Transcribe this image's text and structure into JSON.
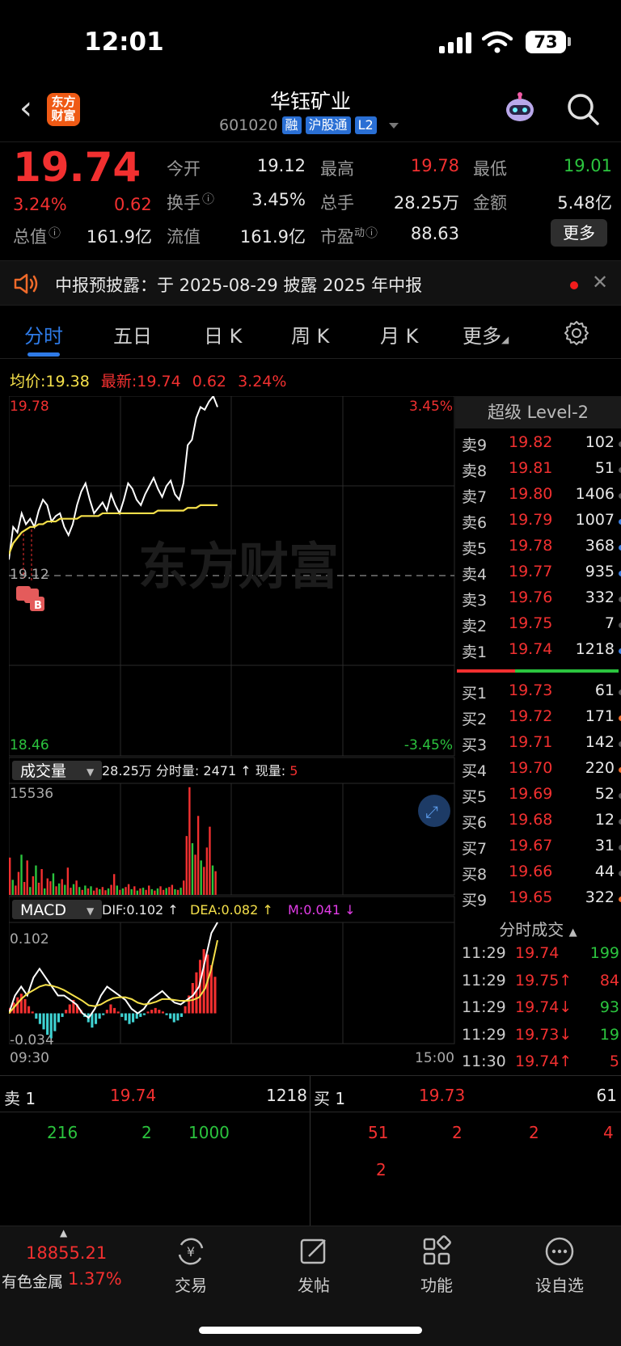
{
  "status": {
    "time": "12:01",
    "battery": "73"
  },
  "header": {
    "logo_text": "东方财富",
    "title": "华钰矿业",
    "code": "601020",
    "tags": [
      "融",
      "沪股通",
      "L2"
    ]
  },
  "quote": {
    "price": "19.74",
    "change_pct": "3.24%",
    "change": "0.62",
    "open_label": "今开",
    "open": "19.12",
    "high_label": "最高",
    "high": "19.78",
    "low_label": "最低",
    "low": "19.01",
    "turnover_label": "换手",
    "turnover": "3.45%",
    "volume_label": "总手",
    "volume": "28.25万",
    "amount_label": "金额",
    "amount": "5.48亿",
    "mktcap_label": "总值",
    "mktcap": "161.9亿",
    "float_label": "流值",
    "float": "161.9亿",
    "pe_label": "市盈",
    "pe_sup": "动",
    "pe": "88.63",
    "more_button": "更多"
  },
  "notice": {
    "text": "中报预披露：于 2025-08-29 披露 2025 年中报"
  },
  "tabs": [
    {
      "label": "分时",
      "active": true
    },
    {
      "label": "五日",
      "active": false
    },
    {
      "label": "日 K",
      "active": false
    },
    {
      "label": "周 K",
      "active": false
    },
    {
      "label": "月 K",
      "active": false
    },
    {
      "label": "更多",
      "active": false
    }
  ],
  "intraday_info": {
    "avg_label": "均价:",
    "avg": "19.38",
    "latest_label": "最新:",
    "latest": "19.74",
    "change": "0.62",
    "change_pct": "3.24%"
  },
  "chart_data": [
    {
      "type": "line",
      "title": "",
      "y_top_label": "19.78",
      "y_mid_label": "19.12",
      "y_bottom_label": "18.46",
      "pct_top_label": "3.45%",
      "pct_bottom_label": "-3.45%",
      "ylim": [
        18.46,
        19.78
      ],
      "series": [
        {
          "name": "",
          "color": "#ffffff",
          "values": [
            19.18,
            19.3,
            19.28,
            19.35,
            19.31,
            19.33,
            19.3,
            19.36,
            19.4,
            19.38,
            19.32,
            19.34,
            19.35,
            19.3,
            19.27,
            19.31,
            19.38,
            19.43,
            19.46,
            19.4,
            19.35,
            19.37,
            19.39,
            19.36,
            19.42,
            19.38,
            19.35,
            19.4,
            19.46,
            19.44,
            19.4,
            19.38,
            19.42,
            19.45,
            19.48,
            19.44,
            19.41,
            19.45,
            19.47,
            19.42,
            19.4,
            19.46,
            19.6,
            19.62,
            19.7,
            19.74,
            19.73,
            19.76,
            19.78,
            19.74
          ]
        },
        {
          "name": "",
          "color": "#f5e04a",
          "values": [
            19.2,
            19.24,
            19.26,
            19.28,
            19.29,
            19.3,
            19.3,
            19.31,
            19.31,
            19.32,
            19.32,
            19.32,
            19.33,
            19.33,
            19.33,
            19.33,
            19.33,
            19.34,
            19.34,
            19.34,
            19.34,
            19.34,
            19.35,
            19.35,
            19.35,
            19.35,
            19.35,
            19.35,
            19.35,
            19.35,
            19.35,
            19.35,
            19.35,
            19.35,
            19.35,
            19.36,
            19.36,
            19.36,
            19.36,
            19.36,
            19.36,
            19.36,
            19.37,
            19.37,
            19.37,
            19.38,
            19.38,
            19.38,
            19.38,
            19.38
          ]
        }
      ]
    },
    {
      "type": "bar",
      "title": "成交量",
      "summary": "28.25万",
      "minute_label": "分时量:",
      "minute_value": "2471",
      "current_label": "现量:",
      "current_value": "5",
      "ymax_label": "15536",
      "ylim": [
        0,
        15536
      ],
      "values": [
        5200,
        2100,
        1300,
        3200,
        5600,
        1800,
        4800,
        1100,
        2600,
        4100,
        1700,
        3600,
        900,
        2300,
        1900,
        3000,
        1200,
        1600,
        2200,
        1400,
        3800,
        1000,
        1500,
        2000,
        1100,
        700,
        1300,
        900,
        1200,
        600,
        1000,
        800,
        1100,
        650,
        900,
        1400,
        2900,
        1300,
        700,
        900,
        1100,
        1500,
        800,
        1200,
        600,
        900,
        1000,
        700,
        1300,
        800,
        600,
        900,
        1200,
        700,
        950,
        1100,
        1400,
        800,
        700,
        1000,
        2000,
        8200,
        15000,
        7200,
        5600,
        11000,
        4800,
        3900,
        6600,
        9500,
        4100,
        3300
      ],
      "colors": [
        "r",
        "g",
        "r",
        "r",
        "g",
        "r",
        "r",
        "g",
        "r",
        "g",
        "r",
        "r",
        "g",
        "r",
        "r",
        "g",
        "r",
        "g",
        "r",
        "g",
        "r",
        "r",
        "g",
        "r",
        "g",
        "r",
        "g",
        "r",
        "g",
        "r",
        "r",
        "g",
        "r",
        "r",
        "g",
        "r",
        "r",
        "g",
        "r",
        "g",
        "r",
        "r",
        "g",
        "r",
        "g",
        "r",
        "g",
        "r",
        "r",
        "g",
        "r",
        "g",
        "r",
        "r",
        "g",
        "r",
        "r",
        "g",
        "r",
        "g",
        "r",
        "r",
        "r",
        "g",
        "r",
        "r",
        "g",
        "r",
        "r",
        "r",
        "g",
        "r"
      ]
    },
    {
      "type": "bar",
      "title": "MACD",
      "dif_label": "DIF:0.102 ↑",
      "dea_label": "DEA:0.082 ↑",
      "m_label": "M:0.041 ↓",
      "ymax_label": "0.102",
      "ymin_label": "-0.034",
      "x_start_label": "09:30",
      "x_end_label": "15:00",
      "ylim": [
        -0.034,
        0.102
      ],
      "values": [
        0.006,
        0.012,
        0.018,
        0.022,
        0.016,
        0.008,
        0.002,
        -0.006,
        -0.012,
        -0.018,
        -0.024,
        -0.028,
        -0.02,
        -0.01,
        -0.004,
        0.004,
        0.01,
        0.015,
        0.01,
        0.004,
        -0.004,
        -0.01,
        -0.016,
        -0.012,
        -0.006,
        -0.002,
        0.004,
        0.01,
        0.006,
        0.002,
        -0.004,
        -0.008,
        -0.012,
        -0.01,
        -0.006,
        -0.004,
        -0.002,
        0.002,
        0.004,
        0.006,
        0.004,
        0.002,
        -0.002,
        -0.006,
        -0.01,
        -0.008,
        -0.004,
        0.008,
        0.02,
        0.034,
        0.046,
        0.06,
        0.072,
        0.066,
        0.054,
        0.041
      ],
      "dif": [
        0.0,
        0.02,
        0.03,
        0.02,
        0.04,
        0.05,
        0.04,
        0.03,
        0.02,
        0.02,
        0.015,
        0.01,
        0.0,
        -0.005,
        0.005,
        0.02,
        0.03,
        0.025,
        0.02,
        0.015,
        0.005,
        0.0,
        0.005,
        0.015,
        0.02,
        0.025,
        0.018,
        0.012,
        0.01,
        0.015,
        0.02,
        0.03,
        0.06,
        0.09,
        0.102
      ],
      "dea": [
        0.0,
        0.008,
        0.016,
        0.022,
        0.026,
        0.03,
        0.032,
        0.031,
        0.029,
        0.026,
        0.022,
        0.018,
        0.014,
        0.009,
        0.008,
        0.01,
        0.014,
        0.017,
        0.018,
        0.018,
        0.016,
        0.012,
        0.01,
        0.011,
        0.013,
        0.016,
        0.016,
        0.015,
        0.014,
        0.014,
        0.015,
        0.018,
        0.028,
        0.05,
        0.082
      ]
    }
  ],
  "orderbook": {
    "asks": [
      {
        "label": "卖9",
        "price": "19.82",
        "vol": "102",
        "dot": "gray"
      },
      {
        "label": "卖8",
        "price": "19.81",
        "vol": "51",
        "dot": "gray"
      },
      {
        "label": "卖7",
        "price": "19.80",
        "vol": "1406",
        "dot": "gray"
      },
      {
        "label": "卖6",
        "price": "19.79",
        "vol": "1007",
        "dot": "blue"
      },
      {
        "label": "卖5",
        "price": "19.78",
        "vol": "368",
        "dot": "blue"
      },
      {
        "label": "卖4",
        "price": "19.77",
        "vol": "935",
        "dot": "blue"
      },
      {
        "label": "卖3",
        "price": "19.76",
        "vol": "332",
        "dot": "gray"
      },
      {
        "label": "卖2",
        "price": "19.75",
        "vol": "7",
        "dot": "gray"
      },
      {
        "label": "卖1",
        "price": "19.74",
        "vol": "1218",
        "dot": "blue"
      }
    ],
    "bids": [
      {
        "label": "买1",
        "price": "19.73",
        "vol": "61",
        "dot": "gray"
      },
      {
        "label": "买2",
        "price": "19.72",
        "vol": "171",
        "dot": "orange"
      },
      {
        "label": "买3",
        "price": "19.71",
        "vol": "142",
        "dot": "gray"
      },
      {
        "label": "买4",
        "price": "19.70",
        "vol": "220",
        "dot": "orange"
      },
      {
        "label": "买5",
        "price": "19.69",
        "vol": "52",
        "dot": "gray"
      },
      {
        "label": "买6",
        "price": "19.68",
        "vol": "12",
        "dot": "gray"
      },
      {
        "label": "买7",
        "price": "19.67",
        "vol": "31",
        "dot": "gray"
      },
      {
        "label": "买8",
        "price": "19.66",
        "vol": "44",
        "dot": "gray"
      },
      {
        "label": "买9",
        "price": "19.65",
        "vol": "322",
        "dot": "orange"
      }
    ]
  },
  "ticks": {
    "title": "分时成交",
    "rows": [
      {
        "time": "11:29",
        "price": "19.74",
        "arrow": "",
        "vol": "199",
        "vol_color": "green"
      },
      {
        "time": "11:29",
        "price": "19.75↑",
        "arrow": "up",
        "vol": "84",
        "vol_color": "red"
      },
      {
        "time": "11:29",
        "price": "19.74↓",
        "arrow": "down",
        "vol": "93",
        "vol_color": "green"
      },
      {
        "time": "11:29",
        "price": "19.73↓",
        "arrow": "down",
        "vol": "19",
        "vol_color": "green"
      },
      {
        "time": "11:30",
        "price": "19.74↑",
        "arrow": "up",
        "vol": "5",
        "vol_color": "red"
      }
    ]
  },
  "queue": {
    "sell_label": "卖 1",
    "sell_price": "19.74",
    "sell_vol": "1218",
    "buy_label": "买 1",
    "buy_price": "19.73",
    "buy_vol": "61",
    "sell_orders": [
      "216",
      "2",
      "1000"
    ],
    "buy_orders": [
      "51",
      "2",
      "2",
      "4",
      "2"
    ]
  },
  "index": {
    "value": "18855.21",
    "name": "有色金属",
    "change_pct": "1.37%"
  },
  "tabbar": [
    {
      "label": "交易",
      "icon": "yuan-exchange-icon"
    },
    {
      "label": "发帖",
      "icon": "edit-post-icon"
    },
    {
      "label": "功能",
      "icon": "grid-apps-icon"
    },
    {
      "label": "设自选",
      "icon": "more-dots-icon"
    }
  ],
  "colors": {
    "up": "#f23030",
    "down": "#2bc43e",
    "accent": "#2e7be8",
    "avg": "#f5e04a"
  }
}
